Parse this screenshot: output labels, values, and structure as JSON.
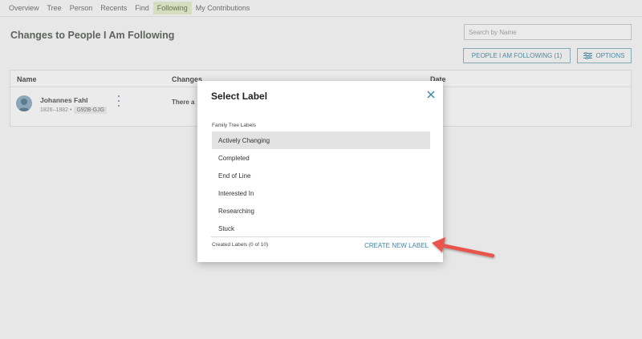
{
  "nav": {
    "tabs": [
      {
        "label": "Overview"
      },
      {
        "label": "Tree"
      },
      {
        "label": "Person"
      },
      {
        "label": "Recents"
      },
      {
        "label": "Find"
      },
      {
        "label": "Following",
        "active": true
      },
      {
        "label": "My Contributions"
      }
    ]
  },
  "page": {
    "title": "Changes to People I Am Following",
    "search_placeholder": "Search by Name",
    "following_button": "PEOPLE I AM FOLLOWING (1)",
    "options_button": "OPTIONS"
  },
  "table": {
    "headers": {
      "name": "Name",
      "changes": "Changes",
      "date": "Date"
    },
    "rows": [
      {
        "name": "Johannes Fahl",
        "lifespan": "1826–1882 •",
        "pid": "G92B-GJG",
        "change": "There a"
      }
    ]
  },
  "modal": {
    "title": "Select Label",
    "section_label": "Family Tree Labels",
    "labels": [
      {
        "text": "Actively Changing",
        "selected": true
      },
      {
        "text": "Completed"
      },
      {
        "text": "End of Line"
      },
      {
        "text": "Interested In"
      },
      {
        "text": "Researching"
      },
      {
        "text": "Stuck"
      }
    ],
    "footer_count": "Created Labels (0 of 10)",
    "create_link": "CREATE NEW LABEL"
  },
  "colors": {
    "accent": "#3b86a7",
    "arrow": "#e8554e",
    "active_tab_bg": "#d5dfc0"
  }
}
